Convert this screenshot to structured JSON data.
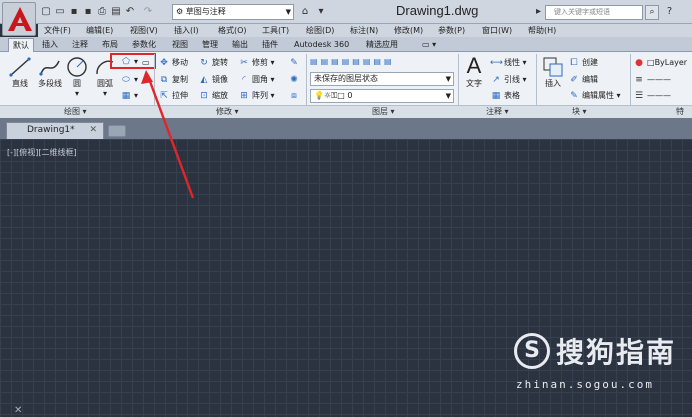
{
  "app": {
    "title": "Drawing1.dwg",
    "workspace": "草图与注释",
    "search_placeholder": "键入关键字或短语"
  },
  "menu": [
    "文件(F)",
    "编辑(E)",
    "视图(V)",
    "插入(I)",
    "格式(O)",
    "工具(T)",
    "绘图(D)",
    "标注(N)",
    "修改(M)",
    "参数(P)",
    "窗口(W)",
    "帮助(H)"
  ],
  "ribbon_tabs": [
    "默认",
    "插入",
    "注释",
    "布局",
    "参数化",
    "视图",
    "管理",
    "输出",
    "插件",
    "Autodesk 360",
    "精选应用"
  ],
  "active_tab": "默认",
  "draw_panel": {
    "title": "绘图",
    "line": "直线",
    "polyline": "多段线",
    "circle": "圆",
    "arc": "圆弧"
  },
  "modify_panel": {
    "title": "修改",
    "move": "移动",
    "rotate": "旋转",
    "trim": "修剪",
    "copy": "复制",
    "mirror": "镜像",
    "fillet": "圆角",
    "stretch": "拉伸",
    "scale": "缩放",
    "array": "阵列"
  },
  "layers_panel": {
    "title": "图层",
    "layer_state": "未保存的图层状态",
    "current_layer": "0"
  },
  "annotation_panel": {
    "title": "注释",
    "text": "文字",
    "linear": "线性",
    "leader": "引线",
    "table": "表格"
  },
  "block_panel": {
    "title": "块",
    "insert": "插入",
    "create": "创建",
    "edit": "编辑",
    "edit_attributes": "编辑属性"
  },
  "properties_panel": {
    "title": "特",
    "color": "ByLayer"
  },
  "document": {
    "tab_label": "Drawing1*",
    "viewport_label": "[-][俯视][二维线框]"
  },
  "watermark": {
    "glyph": "S",
    "brand": "搜狗指南",
    "url": "zhinan.sogou.com"
  },
  "colors": {
    "canvas": "#2b3240",
    "annotation": "#e0262b",
    "autocad_red": "#c8161d"
  }
}
